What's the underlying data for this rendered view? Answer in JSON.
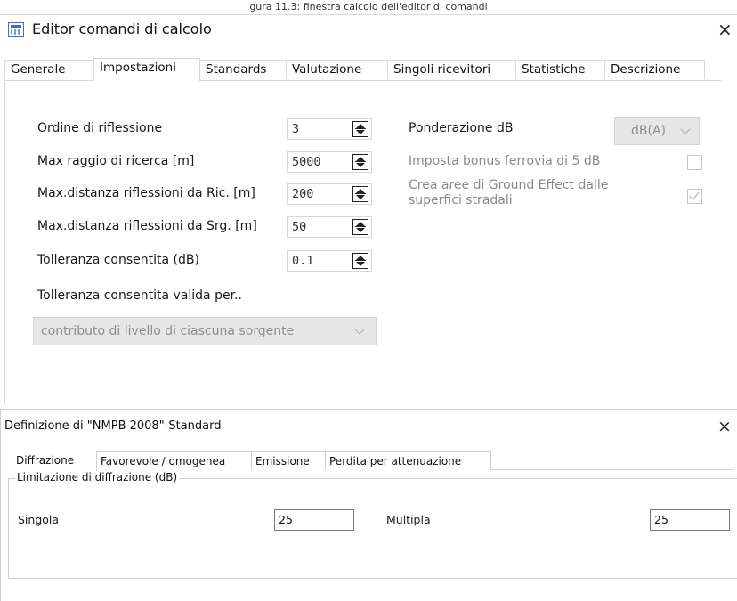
{
  "caption": "gura 11.3: finestra calcolo dell'editor di comandi",
  "window1": {
    "title": "Editor comandi di calcolo",
    "close_glyph": "×",
    "tabs": [
      "Generale",
      "Impostazioni",
      "Standards",
      "Valutazione",
      "Singoli ricevitori",
      "Statistiche",
      "Descrizione"
    ],
    "active_tab": "Impostazioni",
    "fields": [
      {
        "label": "Ordine di riflessione",
        "value": "3"
      },
      {
        "label": "Max raggio di ricerca [m]",
        "value": "5000"
      },
      {
        "label": "Max.distanza riflessioni da Ric. [m]",
        "value": "200"
      },
      {
        "label": "Max.distanza riflessioni da Srg. [m]",
        "value": "50"
      },
      {
        "label": "Tolleranza consentita (dB)",
        "value": "0.1"
      }
    ],
    "tolerance_valid_label": "Tolleranza consentita valida per..",
    "tolerance_valid_value": "contributo di livello di ciascuna sorgente",
    "weighting_label": "Ponderazione dB",
    "weighting_value": "dB(A)",
    "rail_bonus_label": "Imposta bonus ferrovia di 5 dB",
    "rail_bonus_checked": false,
    "ground_effect_label_1": "Crea aree di Ground Effect dalle",
    "ground_effect_label_2": "superfici stradali",
    "ground_effect_checked": true
  },
  "window2": {
    "title": "Definizione di \"NMPB 2008\"-Standard",
    "close_glyph": "×",
    "tabs": [
      "Diffrazione",
      "Favorevole / omogenea",
      "Emissione",
      "Perdita per attenuazione"
    ],
    "active_tab": "Diffrazione",
    "group_legend": "Limitazione di diffrazione (dB)",
    "single_label": "Singola",
    "single_value": "25",
    "multiple_label": "Multipla",
    "multiple_value": "25"
  },
  "colors": {
    "disabled_text": "#8a8a8a",
    "disabled_combo_bg": "#e6e6e6",
    "border": "#d9d9d9"
  }
}
